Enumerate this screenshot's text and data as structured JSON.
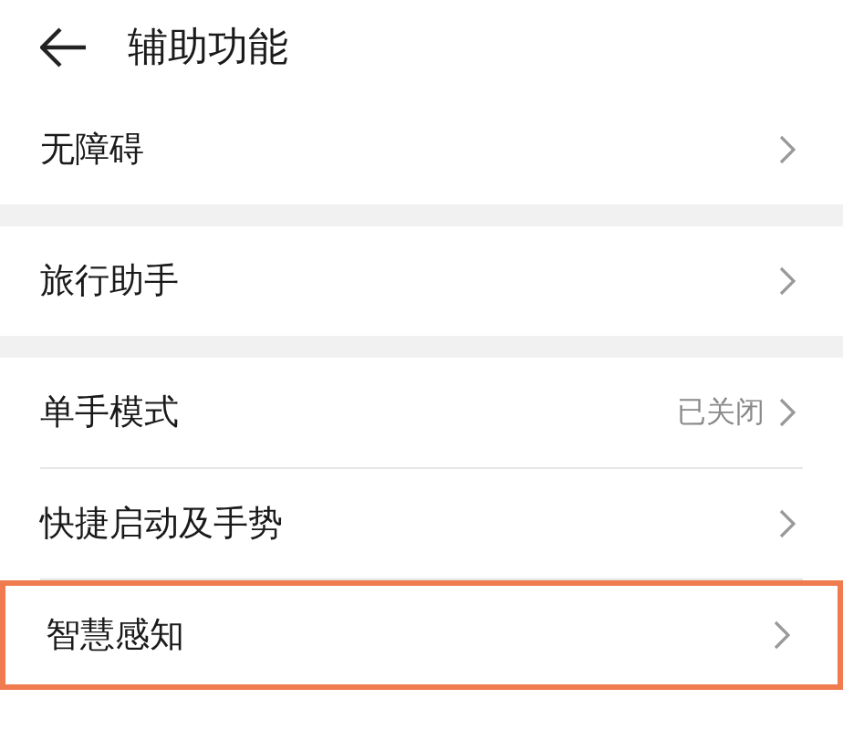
{
  "header": {
    "title": "辅助功能"
  },
  "groups": [
    {
      "items": [
        {
          "label": "无障碍",
          "highlighted": false
        }
      ]
    },
    {
      "items": [
        {
          "label": "旅行助手",
          "highlighted": false
        }
      ]
    },
    {
      "items": [
        {
          "label": "单手模式",
          "value": "已关闭",
          "highlighted": false
        },
        {
          "label": "快捷启动及手势",
          "highlighted": false
        },
        {
          "label": "智慧感知",
          "highlighted": true
        }
      ]
    }
  ]
}
